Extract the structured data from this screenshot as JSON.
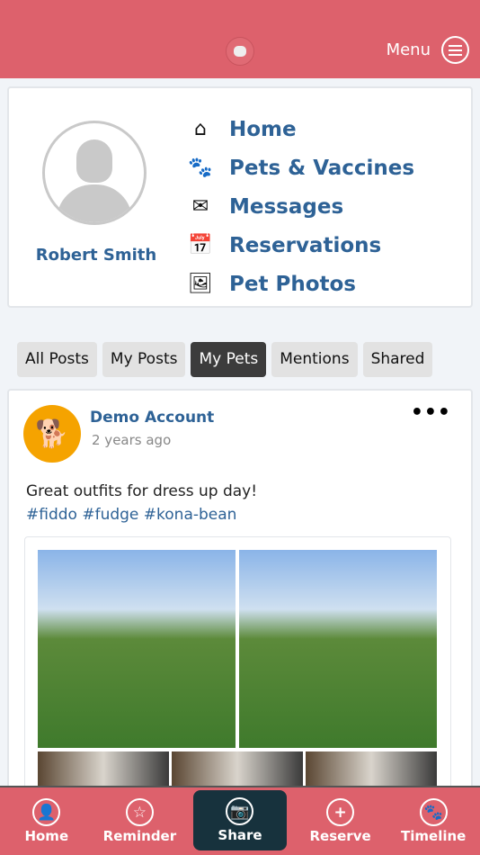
{
  "header": {
    "menu_label": "Menu",
    "logo": "pet-resort-logo"
  },
  "profile": {
    "name": "Robert Smith"
  },
  "nav": [
    {
      "label": "Home",
      "icon": "home-icon",
      "glyph": "⌂"
    },
    {
      "label": "Pets & Vaccines",
      "icon": "paw-icon",
      "glyph": "🐾"
    },
    {
      "label": "Messages",
      "icon": "envelope-icon",
      "glyph": "✉"
    },
    {
      "label": "Reservations",
      "icon": "calendar-icon",
      "glyph": "📅"
    },
    {
      "label": "Pet Photos",
      "icon": "photos-icon",
      "glyph": "🖼"
    }
  ],
  "tabs": [
    {
      "label": "All Posts"
    },
    {
      "label": "My Posts"
    },
    {
      "label": "My Pets",
      "active": true
    },
    {
      "label": "Mentions"
    },
    {
      "label": "Shared"
    }
  ],
  "post": {
    "author": "Demo Account",
    "time": "2 years ago",
    "text": "Great outfits for dress up day!",
    "tags": "#fiddo #fudge #kona-bean",
    "more": "•••"
  },
  "bottom": [
    {
      "label": "Home",
      "icon": "user-icon",
      "glyph": "👤"
    },
    {
      "label": "Reminder",
      "icon": "star-icon",
      "glyph": "☆"
    },
    {
      "label": "Share",
      "icon": "camera-icon",
      "glyph": "📷",
      "active": true
    },
    {
      "label": "Reserve",
      "icon": "plus-icon",
      "glyph": "+"
    },
    {
      "label": "Timeline",
      "icon": "paw-icon",
      "glyph": "🐾"
    }
  ],
  "colors": {
    "brand": "#dd616c",
    "link": "#2e6296",
    "active_tab": "#3c3c3c",
    "share_bg": "#17323d"
  }
}
